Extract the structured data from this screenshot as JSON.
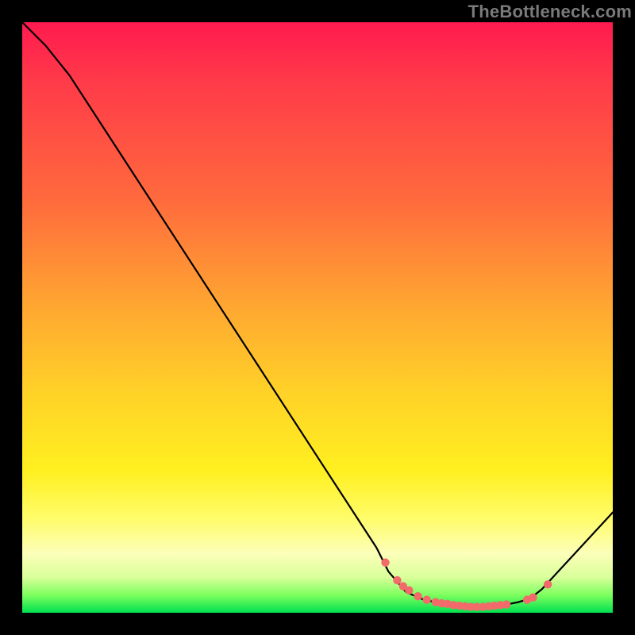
{
  "attribution": "TheBottleneck.com",
  "chart_data": {
    "type": "line",
    "title": "",
    "xlabel": "",
    "ylabel": "",
    "xlim": [
      0,
      100
    ],
    "ylim": [
      0,
      100
    ],
    "series": [
      {
        "name": "curve",
        "x": [
          0,
          4,
          8,
          60,
          62,
          65,
          68,
          70,
          72,
          74,
          76,
          78,
          80,
          82,
          84,
          86,
          88,
          100
        ],
        "y": [
          100,
          96,
          91,
          11,
          7,
          3.5,
          2.2,
          1.8,
          1.5,
          1.2,
          1.0,
          1.0,
          1.2,
          1.4,
          1.8,
          2.4,
          4.0,
          17
        ]
      }
    ],
    "markers": {
      "name": "dots",
      "color": "#f26a6a",
      "points": [
        {
          "x": 61.5,
          "y": 8.5
        },
        {
          "x": 63.5,
          "y": 5.5
        },
        {
          "x": 64.5,
          "y": 4.5
        },
        {
          "x": 65.5,
          "y": 3.8
        },
        {
          "x": 67.0,
          "y": 2.8
        },
        {
          "x": 68.5,
          "y": 2.2
        },
        {
          "x": 70.0,
          "y": 1.8
        },
        {
          "x": 71.0,
          "y": 1.6
        },
        {
          "x": 72.0,
          "y": 1.5
        },
        {
          "x": 73.0,
          "y": 1.3
        },
        {
          "x": 74.0,
          "y": 1.2
        },
        {
          "x": 75.0,
          "y": 1.1
        },
        {
          "x": 76.0,
          "y": 1.0
        },
        {
          "x": 77.0,
          "y": 1.0
        },
        {
          "x": 78.0,
          "y": 1.0
        },
        {
          "x": 79.0,
          "y": 1.1
        },
        {
          "x": 80.0,
          "y": 1.2
        },
        {
          "x": 81.0,
          "y": 1.3
        },
        {
          "x": 82.0,
          "y": 1.4
        },
        {
          "x": 85.5,
          "y": 2.2
        },
        {
          "x": 86.5,
          "y": 2.6
        },
        {
          "x": 89.0,
          "y": 4.8
        }
      ]
    }
  }
}
